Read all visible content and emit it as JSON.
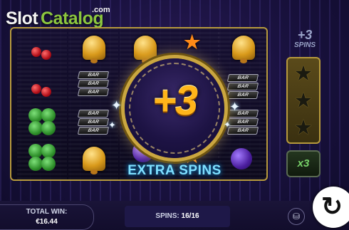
{
  "logo": {
    "word1": "Slot",
    "word2": "Catalog",
    "domain": ".com"
  },
  "side": {
    "plus_label": "+3",
    "spins_label": "SPINS",
    "multiplier": "x3"
  },
  "overlay": {
    "value": "+3",
    "caption": "EXTRA SPINS"
  },
  "reels": {
    "bar_label": "BAR"
  },
  "bottom": {
    "total_win_label": "TOTAL WIN:",
    "total_win_value": "€16.44",
    "spins_label": "SPINS:",
    "spins_value": "16/16"
  },
  "icons": {
    "coins": "coin-stack-icon",
    "spin": "spin-icon"
  },
  "colors": {
    "accent_gold": "#caa640",
    "extra_spins": "#7fe0ff",
    "logo_green": "#8cc63f"
  }
}
